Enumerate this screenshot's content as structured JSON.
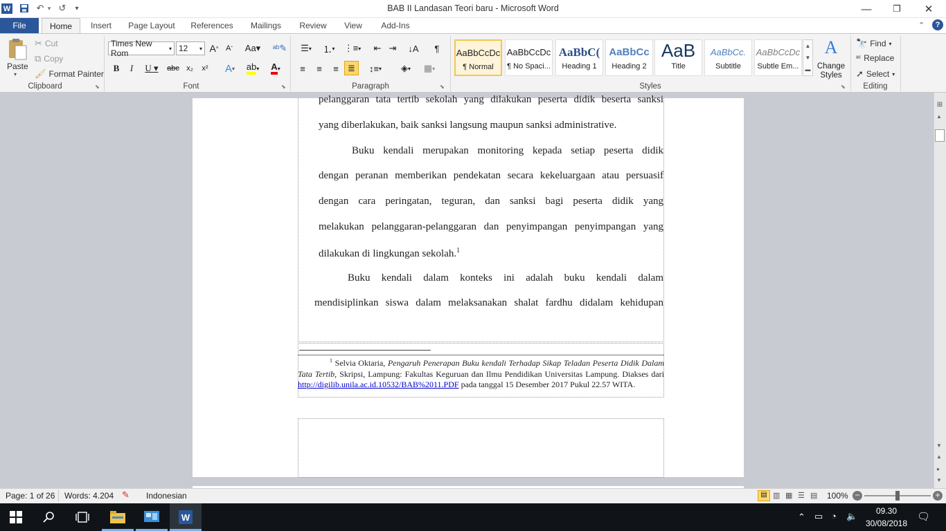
{
  "window": {
    "title": "BAB II Landasan Teori baru  -  Microsoft Word",
    "min_label": "—",
    "max_label": "❐",
    "close_label": "✕"
  },
  "qat": {
    "word_icon": "W",
    "save_icon": "💾",
    "undo_icon": "↶",
    "redo_icon": "↺",
    "more_icon": "▾"
  },
  "tabs": [
    "File",
    "Home",
    "Insert",
    "Page Layout",
    "References",
    "Mailings",
    "Review",
    "View",
    "Add-Ins"
  ],
  "ribbon": {
    "clipboard": {
      "paste": "Paste",
      "cut": "Cut",
      "copy": "Copy",
      "format_painter": "Format Painter",
      "label": "Clipboard"
    },
    "font": {
      "name": "Times New Rom",
      "size": "12",
      "label": "Font"
    },
    "paragraph": {
      "label": "Paragraph"
    },
    "styles": {
      "label": "Styles",
      "items": [
        {
          "preview": "AaBbCcDc",
          "name": "¶ Normal"
        },
        {
          "preview": "AaBbCcDc",
          "name": "¶ No Spaci..."
        },
        {
          "preview": "AaBbC(",
          "name": "Heading 1"
        },
        {
          "preview": "AaBbCc",
          "name": "Heading 2"
        },
        {
          "preview": "AaB",
          "name": "Title"
        },
        {
          "preview": "AaBbCc.",
          "name": "Subtitle"
        },
        {
          "preview": "AaBbCcDc",
          "name": "Subtle Em..."
        }
      ],
      "change_styles": "Change Styles"
    },
    "editing": {
      "find": "Find",
      "replace": "Replace",
      "select": "Select",
      "label": "Editing"
    }
  },
  "document": {
    "lines": [
      "pelanggaran tata tertib sekolah yang dilakukan peserta didik beserta sanksi",
      "yang diberlakukan, baik sanksi langsung maupun sanksi administrative.",
      "Buku kendali merupakan monitoring kepada setiap peserta didik",
      "dengan peranan memberikan pendekatan secara kekeluargaan atau persuasif",
      "dengan cara peringatan, teguran, dan sanksi bagi peserta didik yang",
      "melakukan pelanggaran-pelanggaran dan penyimpangan penyimpangan yang",
      "dilakukan di lingkungan sekolah.",
      "Buku kendali dalam konteks ini adalah buku kendali dalam",
      "mendisiplinkan siswa dalam melaksanakan shalat fardhu didalam kehidupan"
    ],
    "footnote_ref": "1",
    "footnote": {
      "num": "1",
      "author": "Selvia Oktaria,",
      "title": "Pengaruh Penerapan Buku kendali Terhadap Sikap Teladan Peserta Didik Dalam Tata Tertib",
      "pub": ", Skripsi,  Lampung: Fakultas Keguruan dan Ilmu Pendidikan Universitas Lampung. Diakses dari",
      "url": "http://digilib.unila.ac.id.10532/BAB%2011.PDF",
      "tail": "pada tanggal 15 Desember 2017 Pukul 22.57 WITA."
    }
  },
  "status": {
    "page": "Page: 1 of 26",
    "words": "Words: 4.204",
    "language": "Indonesian",
    "zoom": "100%"
  },
  "taskbar": {
    "time": "09.30",
    "date": "30/08/2018"
  }
}
